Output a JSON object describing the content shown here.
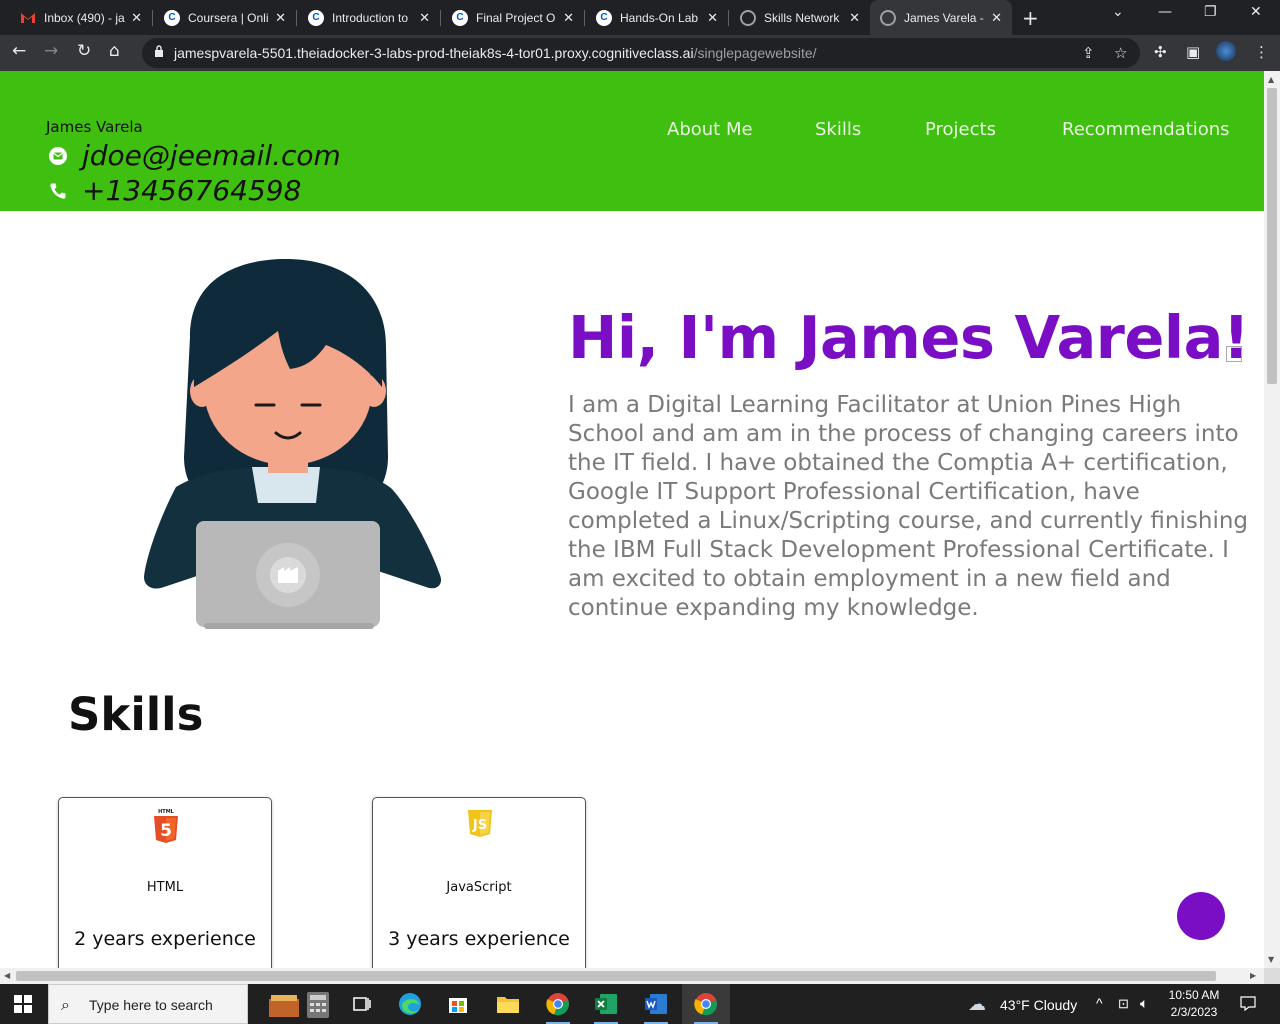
{
  "browser": {
    "tabs": [
      {
        "title": "Inbox (490) - ja",
        "icon": "gmail-icon",
        "color": "#ea4335"
      },
      {
        "title": "Coursera | Onli",
        "icon": "coursera-icon",
        "color": "#0056d2"
      },
      {
        "title": "Introduction to",
        "icon": "coursera-icon",
        "color": "#0056d2"
      },
      {
        "title": "Final Project O",
        "icon": "coursera-icon",
        "color": "#0056d2"
      },
      {
        "title": "Hands-On Lab",
        "icon": "coursera-icon",
        "color": "#0056d2"
      },
      {
        "title": "Skills Network",
        "icon": "globe-icon",
        "color": "#9aa0a6"
      },
      {
        "title": "James Varela -",
        "icon": "globe-icon",
        "color": "#9aa0a6",
        "active": true
      }
    ],
    "url_host": "jamespvarela-5501.theiadocker-3-labs-prod-theiak8s-4-tor01.proxy.cognitiveclass.ai",
    "url_path": "/singlepagewebsite/"
  },
  "site": {
    "brand_name": "James Varela",
    "email": "jdoe@jeemail.com",
    "phone": "+13456764598",
    "nav": [
      "About Me",
      "Skills",
      "Projects",
      "Recommendations"
    ],
    "header_color": "#3fbf0f",
    "accent_color": "#7a0ec4"
  },
  "hero": {
    "title": "Hi, I'm James Varela!",
    "text": "I am a Digital Learning Facilitator at Union Pines High School and am am in the process of changing careers into the IT field. I have obtained the Comptia A+ certification, Google IT Support Professional Certification, have completed a Linux/Scripting course, and currently finishing the IBM Full Stack Development Professional Certificate. I am excited to obtain employment in a new field and continue expanding my knowledge."
  },
  "skills": {
    "title": "Skills",
    "cards": [
      {
        "name": "HTML",
        "experience": "2 years experience",
        "logo": "html5-icon",
        "logo_label": "HTML"
      },
      {
        "name": "JavaScript",
        "experience": "3 years experience",
        "logo": "javascript-icon",
        "logo_label": "JS"
      }
    ]
  },
  "taskbar": {
    "search_placeholder": "Type here to search",
    "weather": "43°F  Cloudy",
    "time": "10:50 AM",
    "date": "2/3/2023"
  }
}
